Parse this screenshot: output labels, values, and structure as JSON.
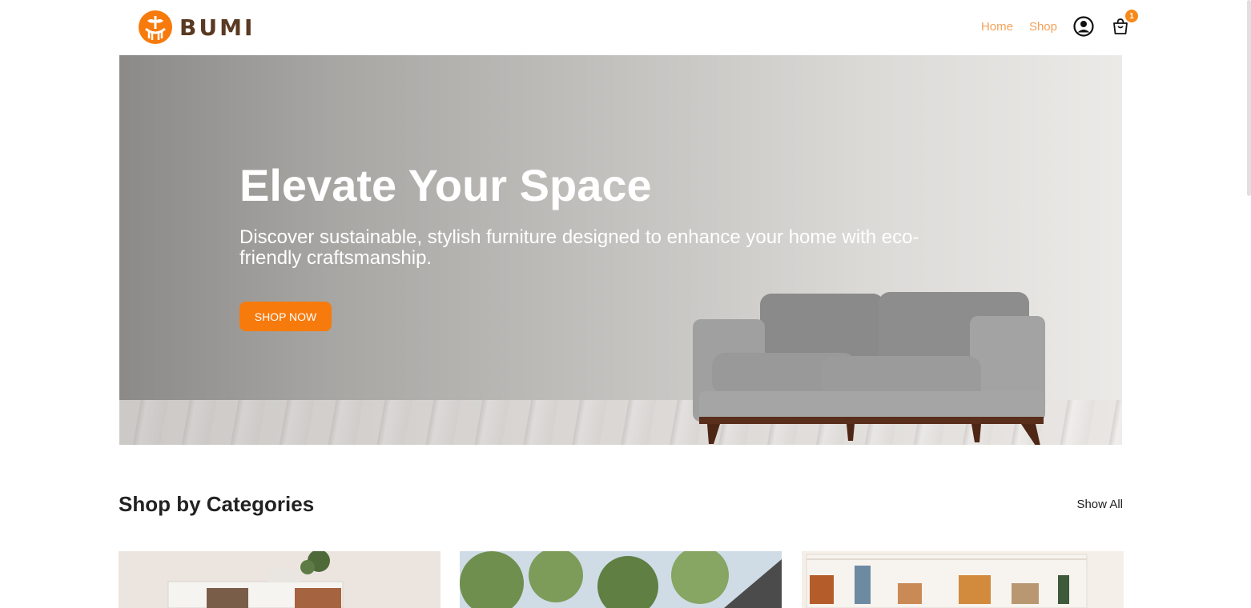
{
  "brand": {
    "name": "BUMI",
    "accent": "#f77a0c",
    "dark": "#5a3a22"
  },
  "nav": {
    "items": [
      {
        "label": "Home"
      },
      {
        "label": "Shop"
      }
    ],
    "icons": {
      "account": "user-circle-icon",
      "cart": "cart-icon"
    },
    "cart_count": "1"
  },
  "hero": {
    "title": "Elevate Your Space",
    "subtitle": "Discover sustainable, stylish furniture designed to enhance your home with eco-friendly craftsmanship.",
    "cta_label": "SHOP NOW"
  },
  "categories": {
    "title": "Shop by Categories",
    "show_all_label": "Show All"
  }
}
